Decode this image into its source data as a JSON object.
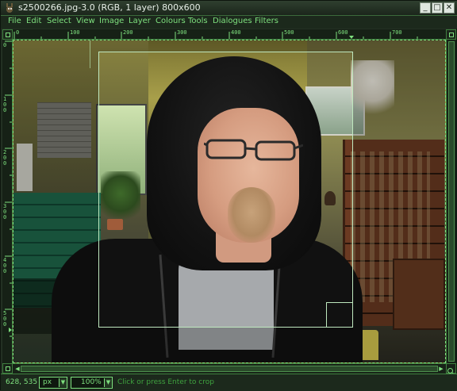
{
  "window": {
    "title": "s2500266.jpg-3.0 (RGB, 1 layer) 800x600",
    "minimize_label": "_",
    "maximize_label": "□",
    "close_label": "✕"
  },
  "menu": {
    "items": [
      "File",
      "Edit",
      "Select",
      "View",
      "Image",
      "Layer",
      "Colours",
      "Tools",
      "Dialogues",
      "Filters"
    ]
  },
  "rulers": {
    "horizontal_labels": [
      "0",
      "100",
      "200",
      "300",
      "400",
      "500",
      "600",
      "700"
    ],
    "vertical_labels": [
      "0",
      "100",
      "200",
      "300",
      "400",
      "500"
    ]
  },
  "status": {
    "coords": "628, 535",
    "unit": "px",
    "zoom": "100%",
    "message": "Click or press Enter to crop"
  },
  "colors": {
    "accent": "#7ee07e",
    "dark_bg": "#1c291c",
    "status_text": "#3fa33f"
  },
  "icons": {
    "app": "gimp-wilber-icon",
    "ruler_corner": "navigate-icon",
    "quick_mask": "quick-mask-icon",
    "zoom_toggle": "zoom-icon"
  }
}
